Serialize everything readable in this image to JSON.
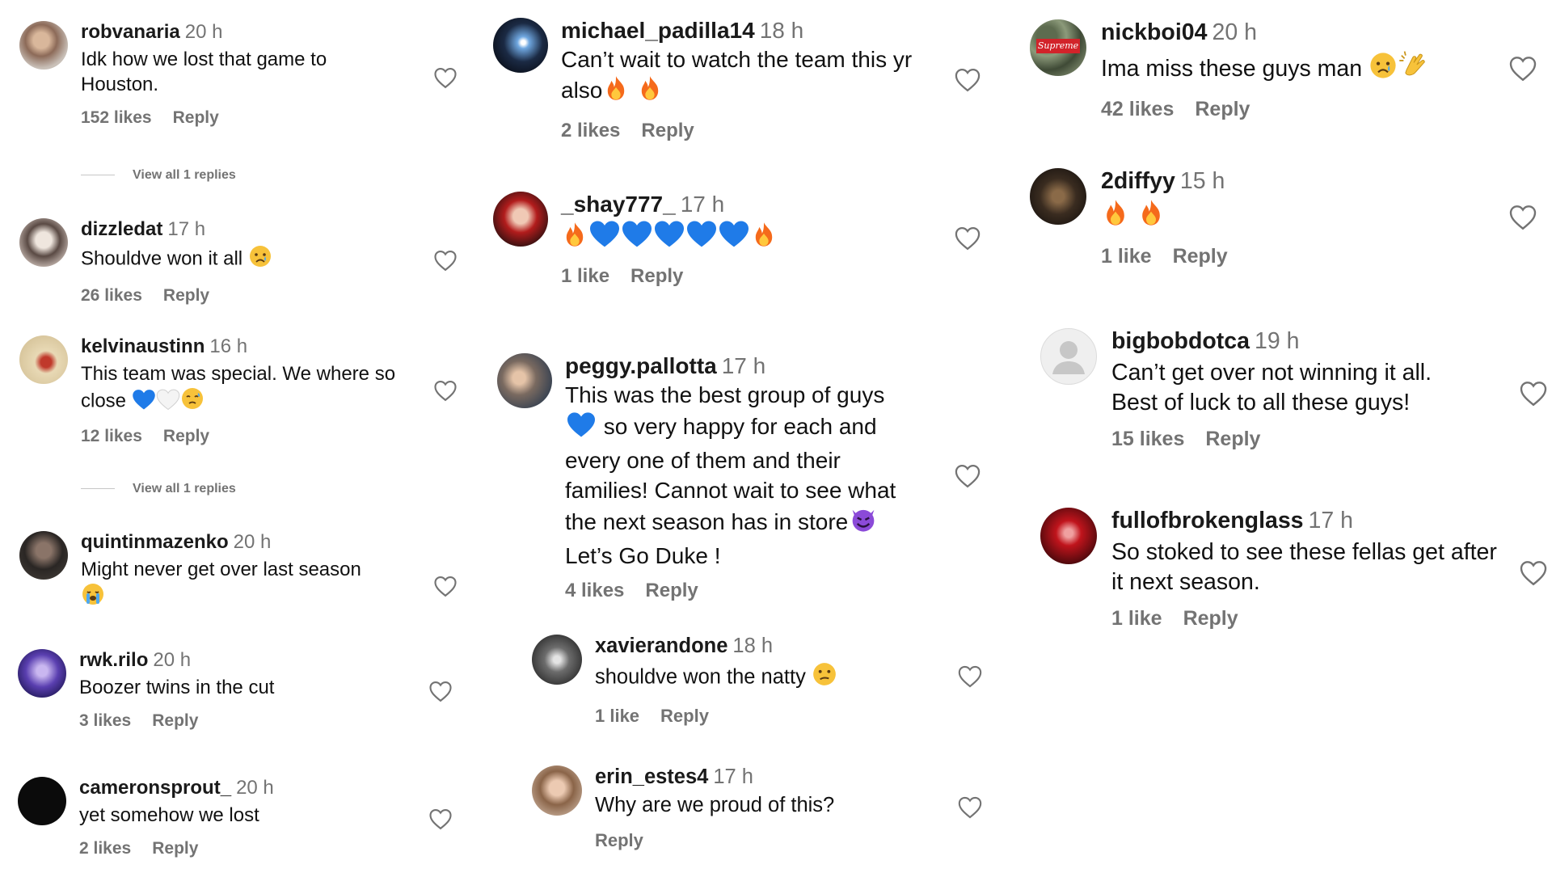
{
  "comments": [
    {
      "user": "robvanaria",
      "time": "20 h",
      "text": "Idk how we lost that game to Houston.",
      "likes": "152 likes",
      "reply": "Reply",
      "view_replies": "View all 1 replies"
    },
    {
      "user": "dizzledat",
      "time": "17 h",
      "text": "Shouldve won it all",
      "likes": "26 likes",
      "reply": "Reply"
    },
    {
      "user": "kelvinaustinn",
      "time": "16 h",
      "text": "This team was special. We where so close",
      "likes": "12 likes",
      "reply": "Reply",
      "view_replies": "View all 1 replies"
    },
    {
      "user": "quintinmazenko",
      "time": "20 h",
      "text": "Might never get over last season",
      "likes": "",
      "reply": ""
    },
    {
      "user": "rwk.rilo",
      "time": "20 h",
      "text": "Boozer twins in the cut",
      "likes": "3 likes",
      "reply": "Reply"
    },
    {
      "user": "cameronsprout_",
      "time": "20 h",
      "text": "yet somehow we lost",
      "likes": "2 likes",
      "reply": "Reply"
    },
    {
      "user": "michael_padilla14",
      "time": "18 h",
      "text": "Can’t wait to watch the team this yr also",
      "likes": "2 likes",
      "reply": "Reply"
    },
    {
      "user": "_shay777_",
      "time": "17 h",
      "text": "",
      "likes": "1 like",
      "reply": "Reply"
    },
    {
      "user": "peggy.pallotta",
      "time": "17 h",
      "text_1": "This was the best group of guys",
      "text_2": "so very happy for each and every one of them and their families! Cannot wait to see what the next season has in store",
      "text_3": "Let’s Go Duke !",
      "likes": "4 likes",
      "reply": "Reply"
    },
    {
      "user": "xavierandone",
      "time": "18 h",
      "text": "shouldve won the natty",
      "likes": "1 like",
      "reply": "Reply"
    },
    {
      "user": "erin_estes4",
      "time": "17 h",
      "text": "Why are we proud of this?",
      "likes": "",
      "reply": "Reply"
    },
    {
      "user": "nickboi04",
      "time": "20 h",
      "text": "Ima miss these guys man",
      "likes": "42 likes",
      "reply": "Reply",
      "avatar_text": "Supreme"
    },
    {
      "user": "2diffyy",
      "time": "15 h",
      "text": "",
      "likes": "1 like",
      "reply": "Reply"
    },
    {
      "user": "bigbobdotca",
      "time": "19 h",
      "text": "Can’t get over not winning it all. Best of luck to all these guys!",
      "likes": "15 likes",
      "reply": "Reply"
    },
    {
      "user": "fullofbrokenglass",
      "time": "17 h",
      "text": "So stoked to see these fellas get after it next season.",
      "likes": "1 like",
      "reply": "Reply"
    }
  ]
}
